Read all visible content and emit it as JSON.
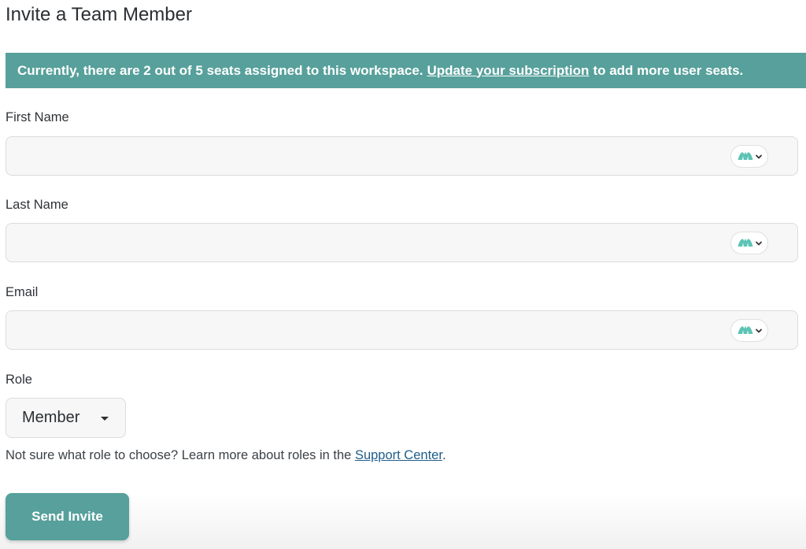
{
  "page": {
    "title": "Invite a Team Member"
  },
  "banner": {
    "text_before": "Currently, there are 2 out of 5 seats assigned to this workspace.",
    "link_text": "Update your subscription",
    "text_after": "to add more user seats.",
    "color": "#57a09b"
  },
  "fields": {
    "first_name": {
      "label": "First Name",
      "value": "",
      "placeholder": ""
    },
    "last_name": {
      "label": "Last Name",
      "value": "",
      "placeholder": ""
    },
    "email": {
      "label": "Email",
      "value": "",
      "placeholder": ""
    },
    "extension_icon": "mountain-logo-icon"
  },
  "role": {
    "label": "Role",
    "selected": "Member"
  },
  "help": {
    "text_before": "Not sure what role to choose? Learn more about roles in the",
    "link_text": "Support Center",
    "text_after": "."
  },
  "actions": {
    "send_label": "Send Invite"
  },
  "colors": {
    "accent": "#57a09b",
    "link": "#1f5d8a",
    "icon_teal": "#5cc4b4"
  }
}
